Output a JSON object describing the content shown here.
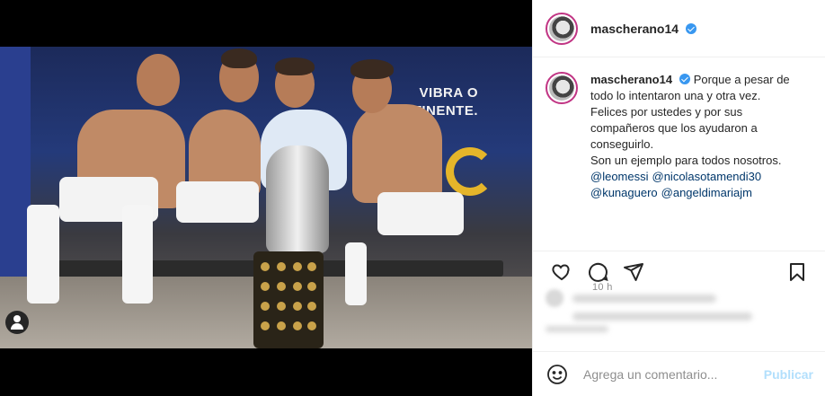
{
  "post": {
    "username": "mascherano14",
    "verified": true,
    "photo_wall_text": [
      "VIBRA O",
      "CONTINENTE."
    ]
  },
  "caption": {
    "username": "mascherano14",
    "lines": [
      "Porque a pesar de",
      "todo lo intentaron una y otra vez.",
      "Felices por ustedes y por sus",
      "compañeros que los ayudaron a",
      "conseguirlo.",
      "Son un ejemplo para todos nosotros."
    ],
    "mentions": [
      "@leomessi",
      "@nicolasotamendi30",
      "@kunaguero",
      "@angeldimariajm"
    ],
    "time": "10 h"
  },
  "actions": {
    "like_icon": "heart-icon",
    "comment_icon": "comment-icon",
    "share_icon": "send-icon",
    "save_icon": "bookmark-icon"
  },
  "comment": {
    "placeholder": "Agrega un comentario...",
    "publish_label": "Publicar",
    "emoji_icon": "emoji-icon"
  },
  "colors": {
    "verified_blue": "#3897f0",
    "mention_blue": "#00376b",
    "publish_disabled": "#b2dffc",
    "meta_gray": "#8e8e8e"
  }
}
